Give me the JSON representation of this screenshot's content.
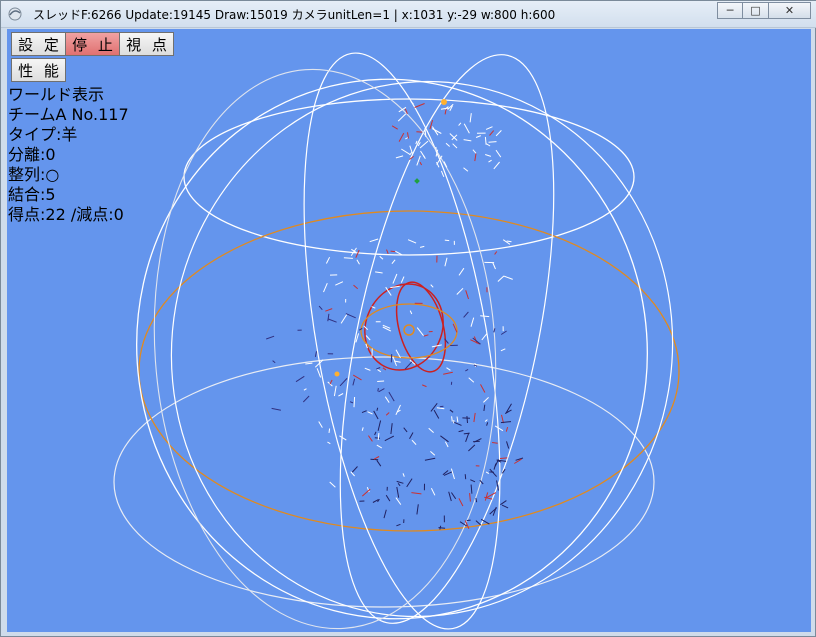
{
  "window": {
    "title": "スレッドF:6266  Update:19145  Draw:15019 カメラunitLen=1 | x:1031  y:-29 w:800 h:600",
    "controls": {
      "minimize": "─",
      "maximize": "□",
      "close": "✕"
    },
    "icons": {
      "app": "app-icon"
    }
  },
  "toolbar": {
    "settings_label": "設 定",
    "stop_label": "停 止",
    "view_label": "視 点",
    "performance_label": "性 能"
  },
  "info": {
    "lines": [
      "ワールド表示",
      "チームA No.117",
      "タイプ:羊",
      "分離:0",
      "整列:○",
      "結合:5",
      "得点:22 /減点:0"
    ]
  },
  "colors": {
    "background": "#6495ed",
    "wire": "#ffffff",
    "orange_ring": "#e08a20",
    "red_ring": "#cc2020",
    "active_button": "#e07070"
  }
}
